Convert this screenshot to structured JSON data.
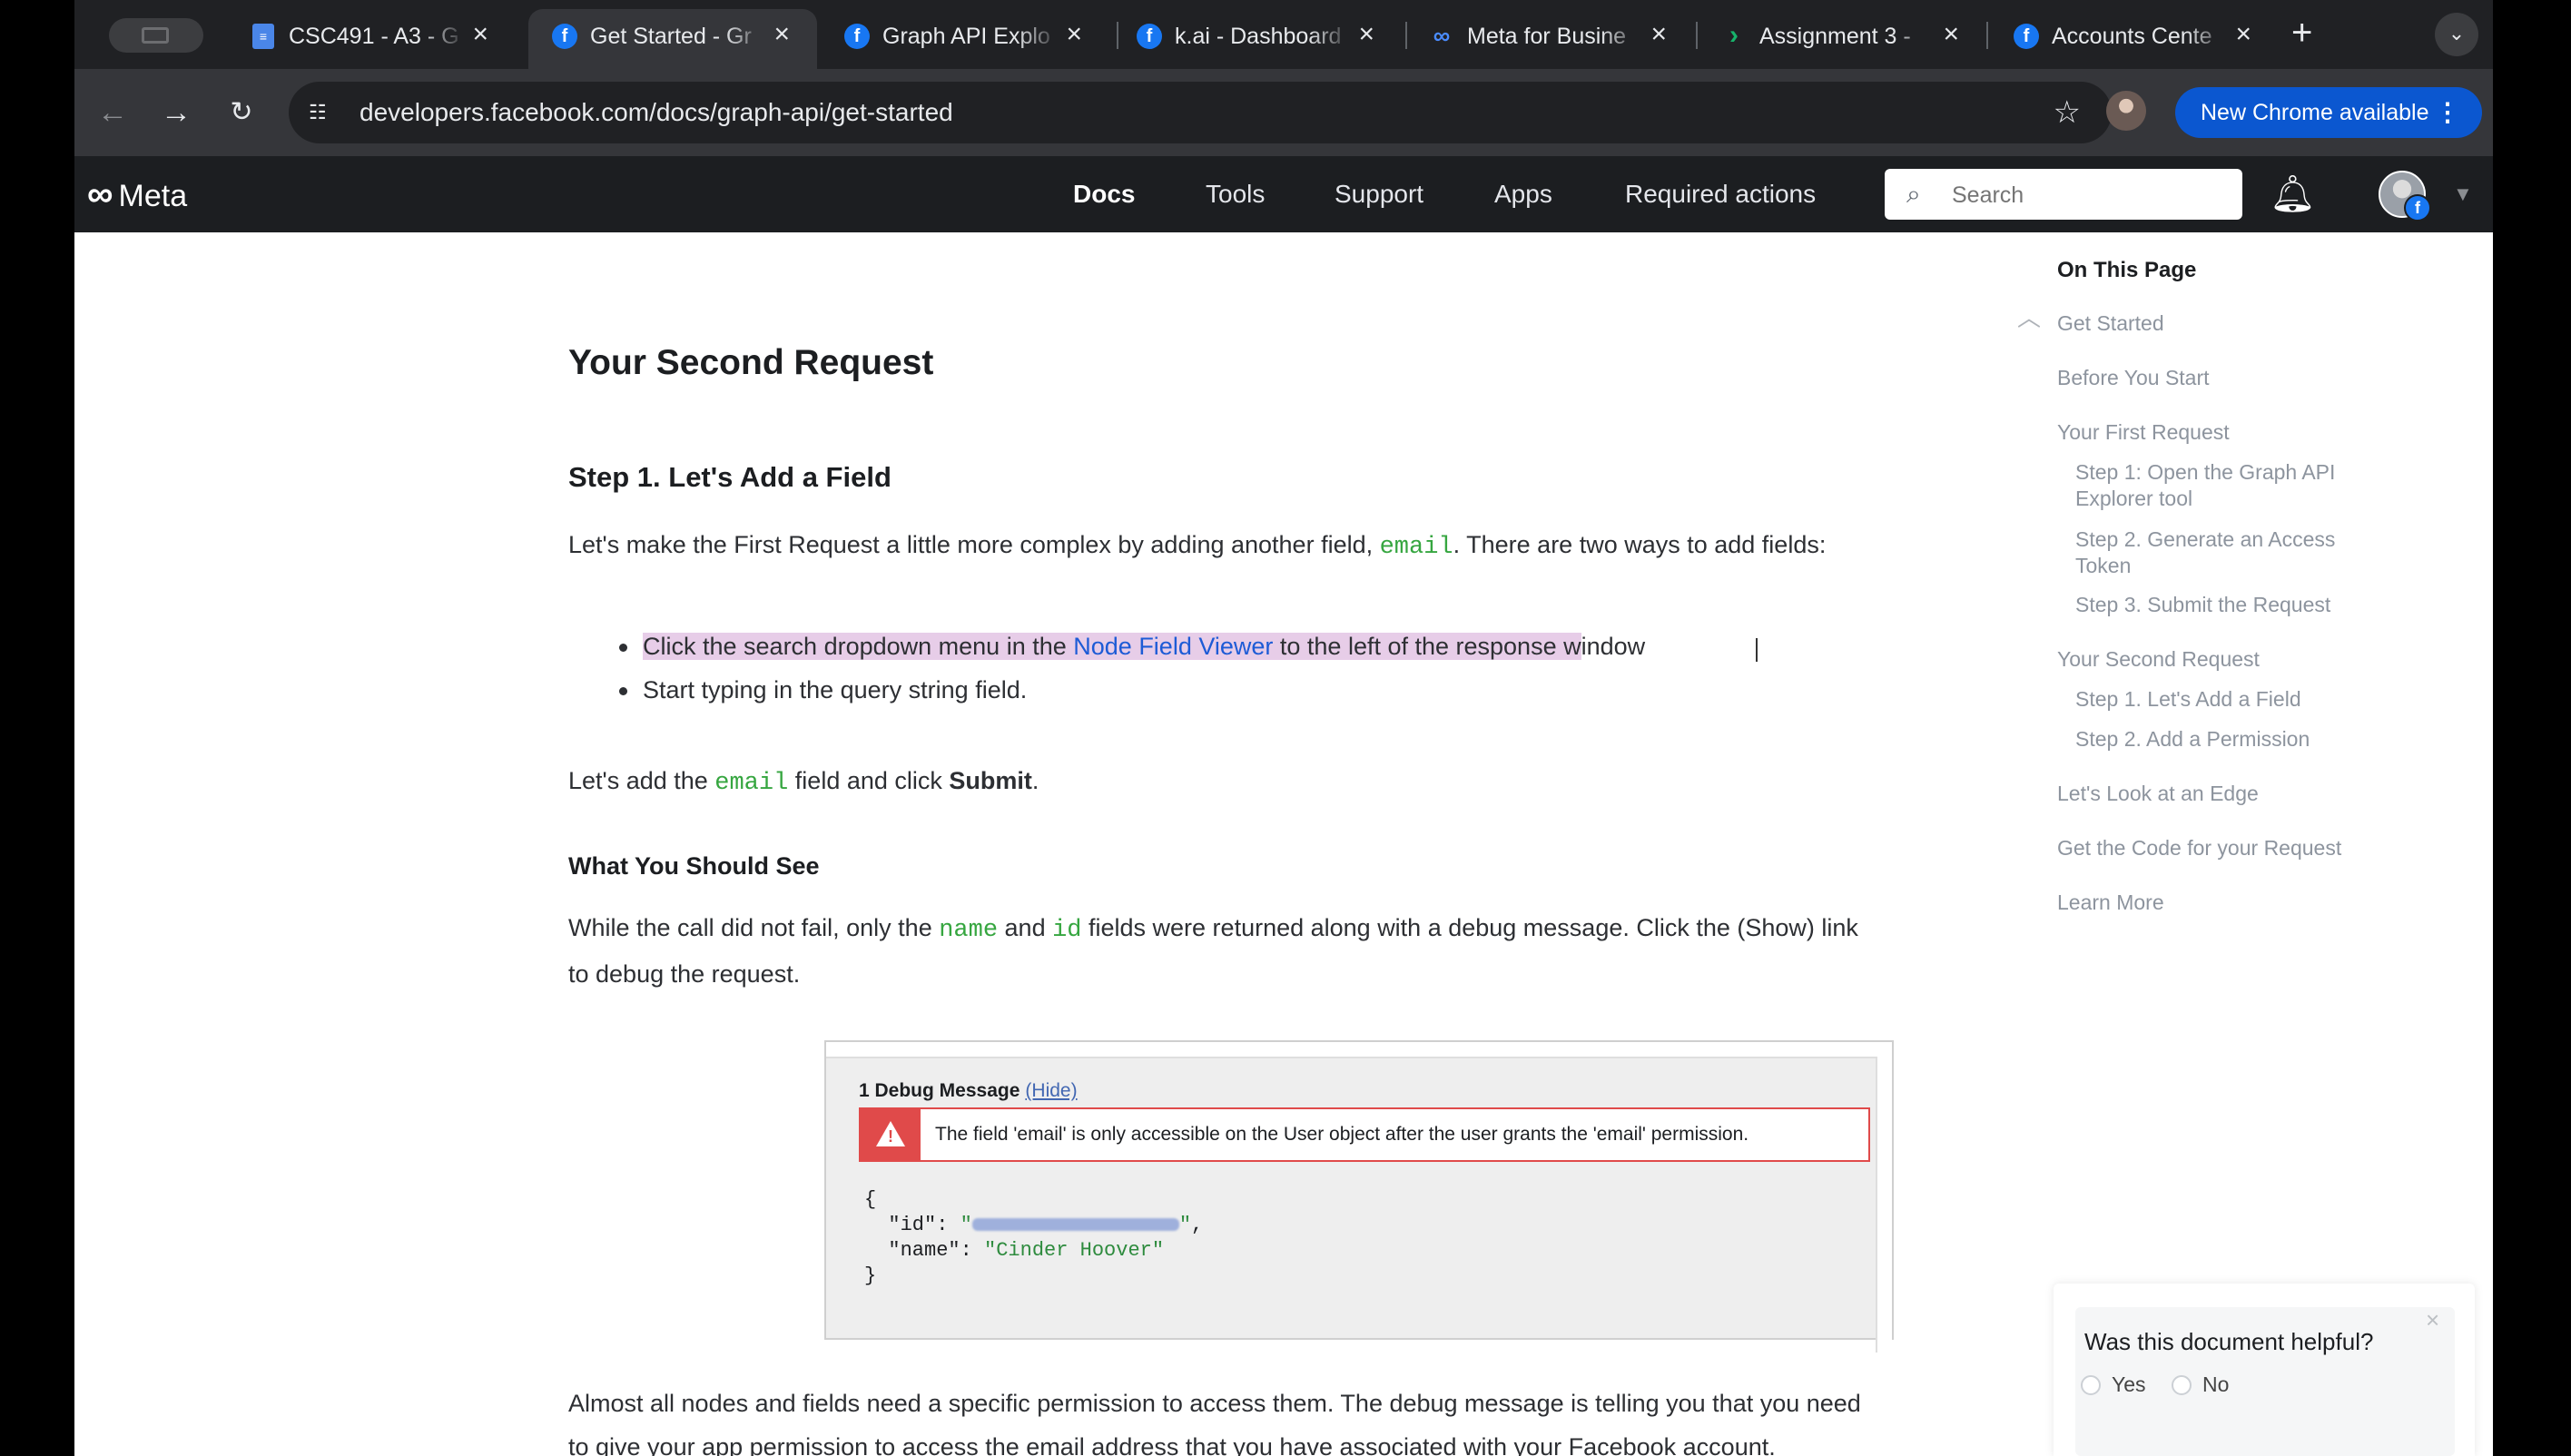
{
  "browser": {
    "tabs": [
      {
        "title": "CSC491 - A3 - G",
        "favicon": "docs-icon"
      },
      {
        "title": "Get Started - Gr",
        "favicon": "facebook-icon",
        "active": true
      },
      {
        "title": "Graph API Explo",
        "favicon": "facebook-icon"
      },
      {
        "title": "k.ai - Dashboard",
        "favicon": "facebook-icon"
      },
      {
        "title": "Meta for Busine",
        "favicon": "meta-icon"
      },
      {
        "title": "Assignment 3 - ",
        "favicon": "arrow-icon"
      },
      {
        "title": "Accounts Cente",
        "favicon": "facebook-icon"
      }
    ],
    "url": "developers.facebook.com/docs/graph-api/get-started",
    "update_button": "New Chrome available"
  },
  "site": {
    "logo": "Meta",
    "nav": [
      "Docs",
      "Tools",
      "Support",
      "Apps",
      "Required actions"
    ],
    "search_placeholder": "Search"
  },
  "article": {
    "h2": "Your Second Request",
    "h3": "Step 1. Let's Add a Field",
    "intro_a": "Let's make the First Request a little more complex by adding another field, ",
    "intro_code": "email",
    "intro_b": ". There are two ways to add fields:",
    "bullet1_a": "Click the search dropdown menu in the ",
    "bullet1_link": "Node Field Viewer",
    "bullet1_b": " to the left of the response w",
    "bullet1_c": "indow",
    "bullet2": "Start typing in the query string field.",
    "add_a": "Let's add the ",
    "add_code": "email",
    "add_b": " field and click ",
    "add_bold": "Submit",
    "add_c": ".",
    "h4": "What You Should See",
    "see_a": "While the call did not fail, only the ",
    "see_code1": "name",
    "see_and": " and ",
    "see_code2": "id",
    "see_b": " fields were returned along with a debug message. Click the (Show) link",
    "see_c": "to debug the request.",
    "perm_line1": "Almost all nodes and fields need a specific permission to access them. The debug message is telling you that you need",
    "perm_line2": "to give your app permission to access the email address that you have associated with your Facebook account."
  },
  "debug_screenshot": {
    "title": "1 Debug Message",
    "hide_link": "(Hide)",
    "message": "The field 'email' is only accessible on the User object after the user grants the 'email' permission.",
    "json_open": "{",
    "id_key": "  \"id\": ",
    "id_value_redacted": true,
    "name_key": "  \"name\": ",
    "name_value": "\"Cinder Hoover\"",
    "json_close": "}"
  },
  "toc": {
    "title": "On This Page",
    "items": [
      {
        "label": "Get Started"
      },
      {
        "label": "Before You Start"
      },
      {
        "label": "Your First Request"
      },
      {
        "label": "Step 1: Open the Graph API Explorer tool"
      },
      {
        "label": "Step 2. Generate an Access Token"
      },
      {
        "label": "Step 3. Submit the Request"
      },
      {
        "label": "Your Second Request"
      },
      {
        "label": "Step 1. Let's Add a Field"
      },
      {
        "label": "Step 2. Add a Permission"
      },
      {
        "label": "Let's Look at an Edge"
      },
      {
        "label": "Get the Code for your Request"
      },
      {
        "label": "Learn More"
      }
    ]
  },
  "feedback": {
    "question": "Was this document helpful?",
    "yes": "Yes",
    "no": "No"
  }
}
